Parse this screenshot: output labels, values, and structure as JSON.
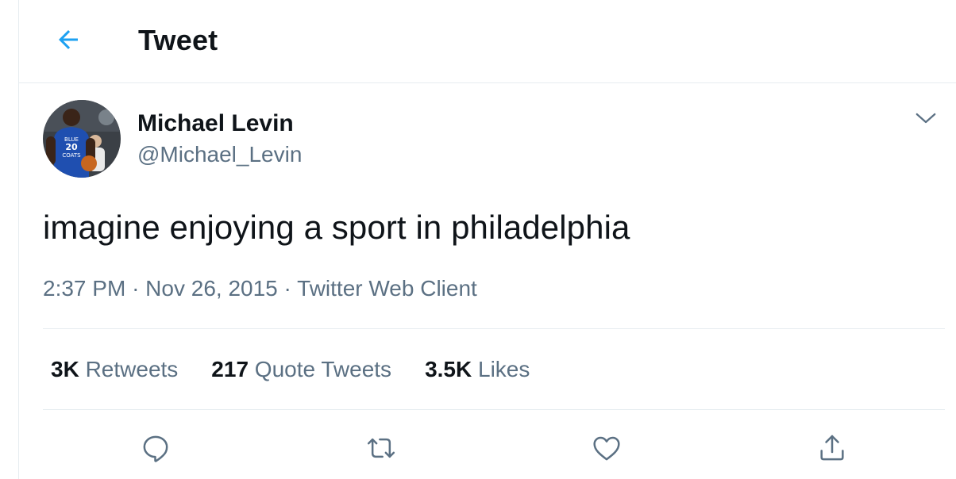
{
  "header": {
    "title": "Tweet",
    "back_icon": "arrow-left-icon"
  },
  "author": {
    "display_name": "Michael Levin",
    "handle": "@Michael_Levin",
    "avatar": "basketball-player-avatar",
    "jersey_text": "BLUE 20 COATS"
  },
  "tweet": {
    "text": "imagine enjoying a sport in philadelphia",
    "time": "2:37 PM",
    "separator": "·",
    "date": "Nov 26, 2015",
    "source": "Twitter Web Client"
  },
  "stats": [
    {
      "count": "3K",
      "label": "Retweets"
    },
    {
      "count": "217",
      "label": "Quote Tweets"
    },
    {
      "count": "3.5K",
      "label": "Likes"
    }
  ],
  "actions": [
    "reply-icon",
    "retweet-icon",
    "like-icon",
    "share-icon"
  ],
  "colors": {
    "accent": "#1da1f2",
    "text_primary": "#0f1419",
    "text_secondary": "#5b7083",
    "border": "#e6ecf0"
  }
}
